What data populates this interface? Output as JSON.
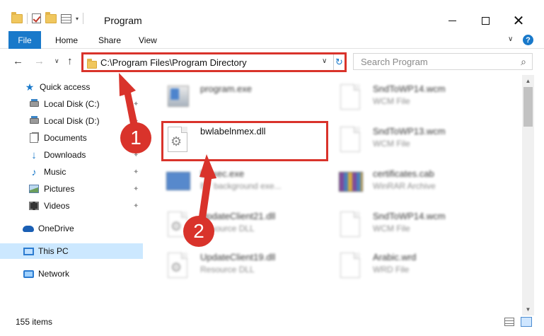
{
  "window": {
    "title": "Program",
    "controls": {
      "minimize": "—",
      "maximize": "",
      "close": "✕"
    }
  },
  "ribbon": {
    "tabs": [
      {
        "label": "File",
        "active": true
      },
      {
        "label": "Home"
      },
      {
        "label": "Share"
      },
      {
        "label": "View"
      }
    ],
    "expand_icon": "∨",
    "help": "?"
  },
  "nav": {
    "back": "←",
    "forward": "→",
    "recent": "∨",
    "up": "↑",
    "address": "C:\\Program Files\\Program Directory",
    "address_dropdown": "∨",
    "refresh": "↻",
    "search_placeholder": "Search Program",
    "search_icon": "⌕"
  },
  "sidebar": {
    "items": [
      {
        "label": "Quick access",
        "icon": "star-icon"
      },
      {
        "label": "Local Disk (C:)",
        "icon": "drive-icon",
        "pinned": true
      },
      {
        "label": "Local Disk (D:)",
        "icon": "drive-icon",
        "pinned": true
      },
      {
        "label": "Documents",
        "icon": "documents-icon",
        "pinned": true
      },
      {
        "label": "Downloads",
        "icon": "downloads-icon",
        "pinned": true
      },
      {
        "label": "Music",
        "icon": "music-icon",
        "pinned": true
      },
      {
        "label": "Pictures",
        "icon": "pictures-icon",
        "pinned": true
      },
      {
        "label": "Videos",
        "icon": "videos-icon",
        "pinned": true
      },
      {
        "label": "OneDrive",
        "icon": "onedrive-icon"
      },
      {
        "label": "This PC",
        "icon": "this-pc-icon",
        "selected": true
      },
      {
        "label": "Network",
        "icon": "network-icon"
      }
    ],
    "pin_glyph": "📌"
  },
  "files": [
    {
      "name": "program.exe",
      "type": "",
      "icon": "exe-icon"
    },
    {
      "name": "SndToWP14.wcm",
      "type": "WCM File",
      "icon": "document-icon"
    },
    {
      "name": "bwlabelnmex.dll",
      "type": "",
      "icon": "dll-gear-icon"
    },
    {
      "name": "SndToWP13.wcm",
      "type": "WCM File",
      "icon": "document-icon"
    },
    {
      "name": "BExec.exe",
      "type": "BY background exe...",
      "icon": "app-icon"
    },
    {
      "name": "certificates.cab",
      "type": "WinRAR Archive",
      "icon": "archive-icon"
    },
    {
      "name": "UpdateClient21.dll",
      "type": "Resource DLL",
      "icon": "dll-gear-icon"
    },
    {
      "name": "SndToWP14.wcm",
      "type": "WCM File",
      "icon": "document-icon"
    },
    {
      "name": "UpdateClient19.dll",
      "type": "Resource DLL",
      "icon": "dll-gear-icon"
    },
    {
      "name": "Arabic.wrd",
      "type": "WRD File",
      "icon": "document-icon"
    }
  ],
  "annotations": {
    "step1": "1",
    "step2": "2",
    "color": "#d9332b"
  },
  "status": {
    "item_count": "155 items"
  },
  "colors": {
    "accent": "#1979ca",
    "selected_bg": "#cce8ff",
    "highlight": "#d9332b"
  }
}
